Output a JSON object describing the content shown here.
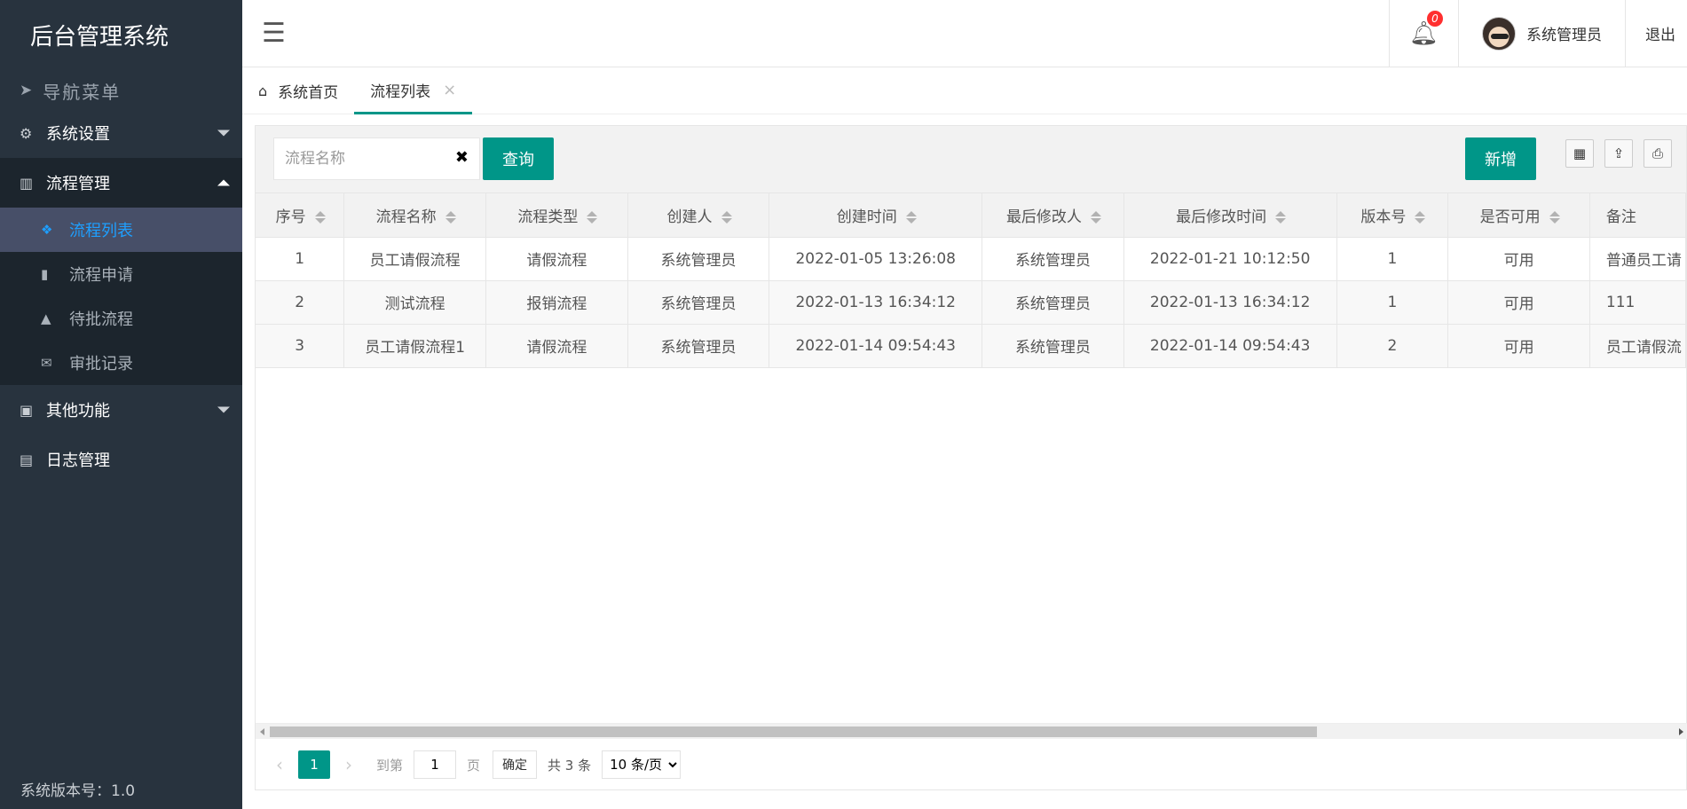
{
  "app": {
    "title": "后台管理系统",
    "version_text": "系统版本号：1.0"
  },
  "sidebar": {
    "nav_header": "导航菜单",
    "menus": [
      {
        "label": "系统设置",
        "icon": "gear-icon"
      },
      {
        "label": "流程管理",
        "icon": "barcode-icon"
      },
      {
        "label": "其他功能",
        "icon": "briefcase-icon"
      },
      {
        "label": "日志管理",
        "icon": "book-icon"
      }
    ],
    "submenu": [
      {
        "label": "流程列表",
        "icon": "dropbox-icon",
        "active": true
      },
      {
        "label": "流程申请",
        "icon": "bar-chart-icon"
      },
      {
        "label": "待批流程",
        "icon": "warning-icon"
      },
      {
        "label": "审批记录",
        "icon": "envelope-icon"
      }
    ]
  },
  "topbar": {
    "notification_count": "0",
    "username": "系统管理员",
    "logout_label": "退出"
  },
  "tabs": [
    {
      "label": "系统首页",
      "icon": "home-icon"
    },
    {
      "label": "流程列表",
      "active": true
    }
  ],
  "toolbar": {
    "search_placeholder": "流程名称",
    "query_label": "查询",
    "add_label": "新增",
    "clear_glyph": "✖"
  },
  "table": {
    "columns": [
      "序号",
      "流程名称",
      "流程类型",
      "创建人",
      "创建时间",
      "最后修改人",
      "最后修改时间",
      "版本号",
      "是否可用",
      "备注"
    ],
    "rows": [
      [
        "1",
        "员工请假流程",
        "请假流程",
        "系统管理员",
        "2022-01-05 13:26:08",
        "系统管理员",
        "2022-01-21 10:12:50",
        "1",
        "可用",
        "普通员工请"
      ],
      [
        "2",
        "测试流程",
        "报销流程",
        "系统管理员",
        "2022-01-13 16:34:12",
        "系统管理员",
        "2022-01-13 16:34:12",
        "1",
        "可用",
        "111"
      ],
      [
        "3",
        "员工请假流程1",
        "请假流程",
        "系统管理员",
        "2022-01-14 09:54:43",
        "系统管理员",
        "2022-01-14 09:54:43",
        "2",
        "可用",
        "员工请假流"
      ]
    ]
  },
  "pager": {
    "current_page": "1",
    "goto_label": "到第",
    "goto_value": "1",
    "page_label": "页",
    "confirm_label": "确定",
    "total_text": "共 3 条",
    "page_size": "10 条/页"
  },
  "colors": {
    "sidebar_bg": "#28333e",
    "accent": "#009688",
    "active_sub": "#1e9fff",
    "badge": "#ff2f2f"
  }
}
